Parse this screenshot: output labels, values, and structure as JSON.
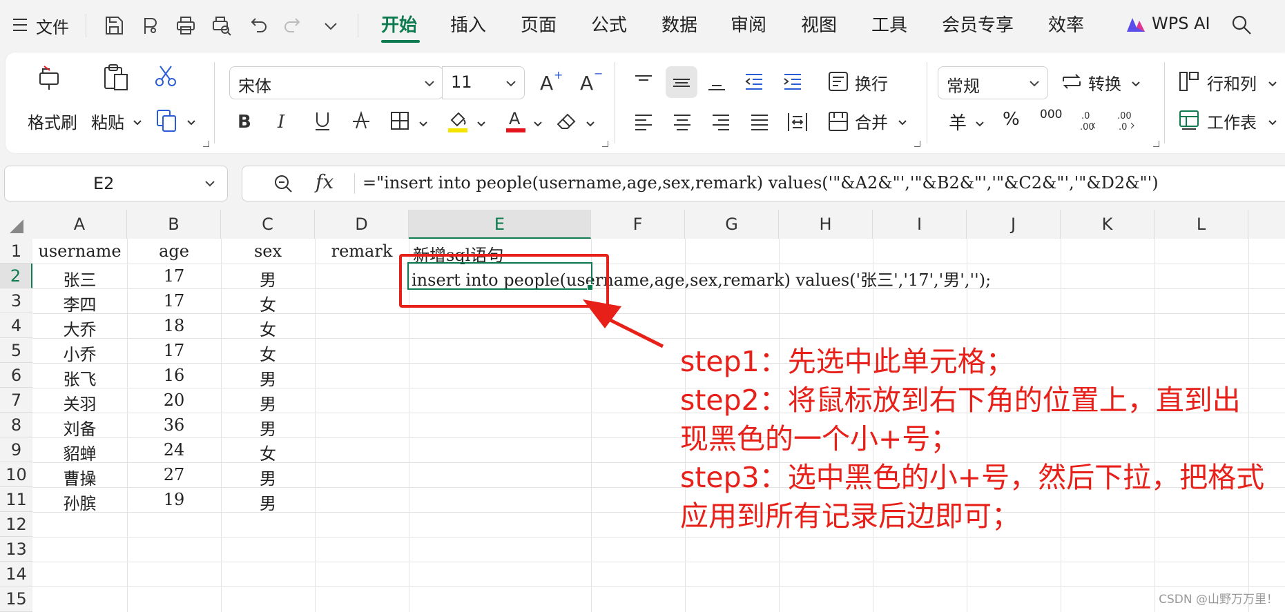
{
  "menu": {
    "hamburger_label": "文件",
    "tabs": [
      {
        "label": "开始",
        "active": true
      },
      {
        "label": "插入",
        "active": false
      },
      {
        "label": "页面",
        "active": false
      },
      {
        "label": "公式",
        "active": false
      },
      {
        "label": "数据",
        "active": false
      },
      {
        "label": "审阅",
        "active": false
      },
      {
        "label": "视图",
        "active": false
      },
      {
        "label": "工具",
        "active": false
      },
      {
        "label": "会员专享",
        "active": false
      },
      {
        "label": "效率",
        "active": false
      }
    ],
    "wps_ai": "WPS AI",
    "accent": "#0e7a4f"
  },
  "ribbon": {
    "format_painter": "格式刷",
    "paste": "粘贴",
    "font_name": "宋体",
    "font_size": "11",
    "wrap_text": "换行",
    "merge": "合并",
    "number_format": "常规",
    "convert": "转换",
    "rows_cols": "行和列",
    "worksheet": "工作表",
    "currency_symbol": "羊",
    "percent_symbol": "%",
    "thousands_symbol": "000",
    "highlight_color": "#f5e400",
    "font_color": "#e3141b"
  },
  "formula": {
    "cell_ref": "E2",
    "fx": "fx",
    "content": "=\"insert into people(username,age,sex,remark) values('\"&A2&\"','\"&B2&\"','\"&C2&\"','\"&D2&\"')"
  },
  "sheet": {
    "columns": [
      "A",
      "B",
      "C",
      "D",
      "E",
      "F",
      "G",
      "H",
      "I",
      "J",
      "K",
      "L"
    ],
    "selected_column": "E",
    "selected_row": "2",
    "rows": [
      "1",
      "2",
      "3",
      "4",
      "5",
      "6",
      "7",
      "8",
      "9",
      "10",
      "11",
      "12",
      "13",
      "14",
      "15"
    ],
    "header": [
      "username",
      "age",
      "sex",
      "remark",
      "新增sql语句"
    ],
    "records": [
      [
        "张三",
        "17",
        "男"
      ],
      [
        "李四",
        "17",
        "女"
      ],
      [
        "大乔",
        "18",
        "女"
      ],
      [
        "小乔",
        "17",
        "女"
      ],
      [
        "张飞",
        "16",
        "男"
      ],
      [
        "关羽",
        "20",
        "男"
      ],
      [
        "刘备",
        "36",
        "男"
      ],
      [
        "貂蝉",
        "24",
        "女"
      ],
      [
        "曹操",
        "27",
        "男"
      ],
      [
        "孙膑",
        "19",
        "男"
      ]
    ],
    "e2_value": "insert into people(username,age,sex,remark) values('张三','17','男','');"
  },
  "annotation": {
    "lines": [
      "step1：先选中此单元格；",
      "step2：将鼠标放到右下角的位置上，直到出",
      "现黑色的一个小+号；",
      "step3：选中黑色的小+号，然后下拉，把格式",
      "应用到所有记录后边即可；"
    ],
    "color": "#e8201a"
  },
  "watermark": "CSDN @山野万万里！"
}
